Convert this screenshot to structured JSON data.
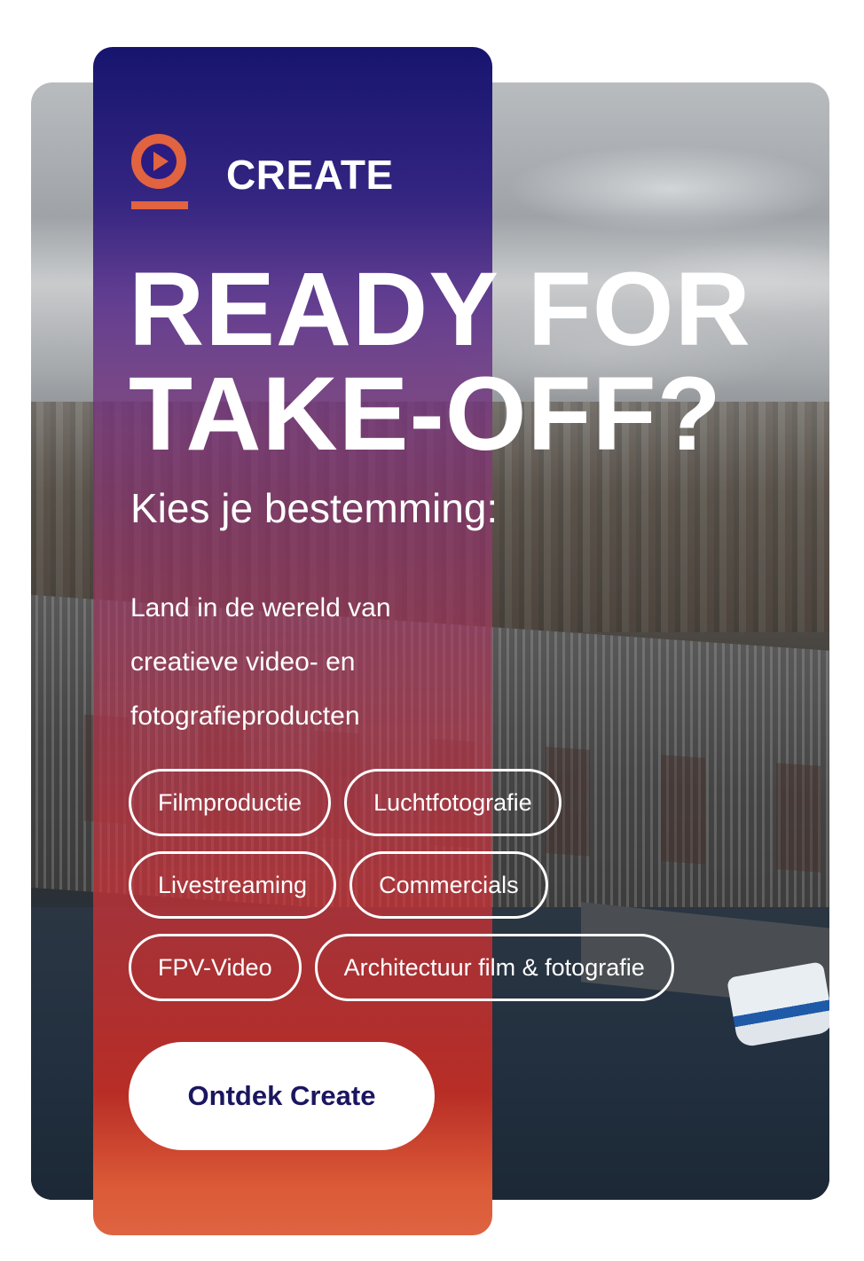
{
  "brand": {
    "name": "CREATE",
    "icon": "play-icon",
    "accent": "#e1633f"
  },
  "hero": {
    "headline_line1": "READY FOR",
    "headline_line2": "TAKE-OFF?",
    "subheading": "Kies je bestemming:",
    "description": "Land in de wereld van creatieve video- en fotografieproducten"
  },
  "tags": [
    [
      "Filmproductie",
      "Luchtfotografie"
    ],
    [
      "Livestreaming",
      "Commercials"
    ],
    [
      "FPV-Video",
      "Architectuur film & fotografie"
    ]
  ],
  "cta": {
    "label": "Ontdek Create",
    "text_color": "#1b1660"
  },
  "colors": {
    "panel_top": "#16146e",
    "panel_bottom": "#de6441"
  }
}
